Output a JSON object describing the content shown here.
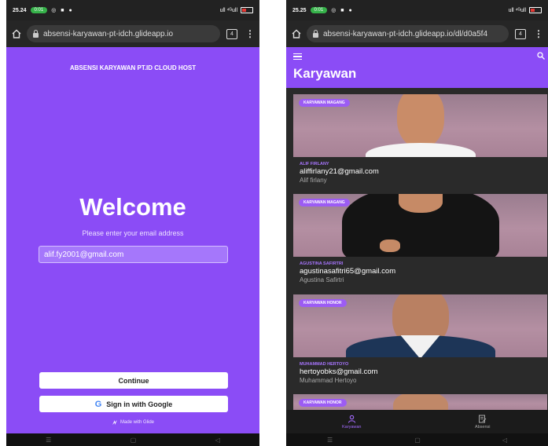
{
  "left_phone": {
    "status": {
      "time": "25.24",
      "badge": "0:01",
      "icons": "◎ ■ ●",
      "signal": "ull ⁴ᴳull"
    },
    "url": "absensi-karyawan-pt-idch.glideapp.io",
    "tab_count": "4",
    "brand_title": "ABSENSI KARYAWAN PT.ID CLOUD HOST",
    "welcome": "Welcome",
    "prompt": "Please enter your email address",
    "email_value": "alif.fy2001@gmail.com",
    "continue_label": "Continue",
    "google_label": "Sign in with Google",
    "made_with": "Made with Glide"
  },
  "right_phone": {
    "status": {
      "time": "25.25",
      "badge": "0:01",
      "icons": "◎ ■ ●",
      "signal": "ull ⁴ᴳull"
    },
    "url": "absensi-karyawan-pt-idch.glideapp.io/dl/d0a5f4",
    "tab_count": "4",
    "page_title": "Karyawan",
    "employees": [
      {
        "badge": "KARYAWAN MAGANG",
        "category": "ALIF FIRLANY",
        "email": "aliffirlany21@gmail.com",
        "name": "Alif firlany"
      },
      {
        "badge": "KARYAWAN MAGANG",
        "category": "AGUSTINA SAFIRTRI",
        "email": "agustinasafitri65@gmail.com",
        "name": "Agustina Safirtri"
      },
      {
        "badge": "KARYAWAN HONOR",
        "category": "MUHAMMAD HERTOYO",
        "email": "hertoyobks@gmail.com",
        "name": "Muhammad Hertoyo"
      },
      {
        "badge": "KARYAWAN HONOR"
      }
    ],
    "tabs": [
      {
        "label": "Karyawan",
        "icon": "person-icon"
      },
      {
        "label": "Absensi",
        "icon": "edit-document-icon"
      }
    ]
  },
  "colors": {
    "accent": "#8b4cf6",
    "badge": "#9c5cf4",
    "dark": "#2a2a2a"
  }
}
